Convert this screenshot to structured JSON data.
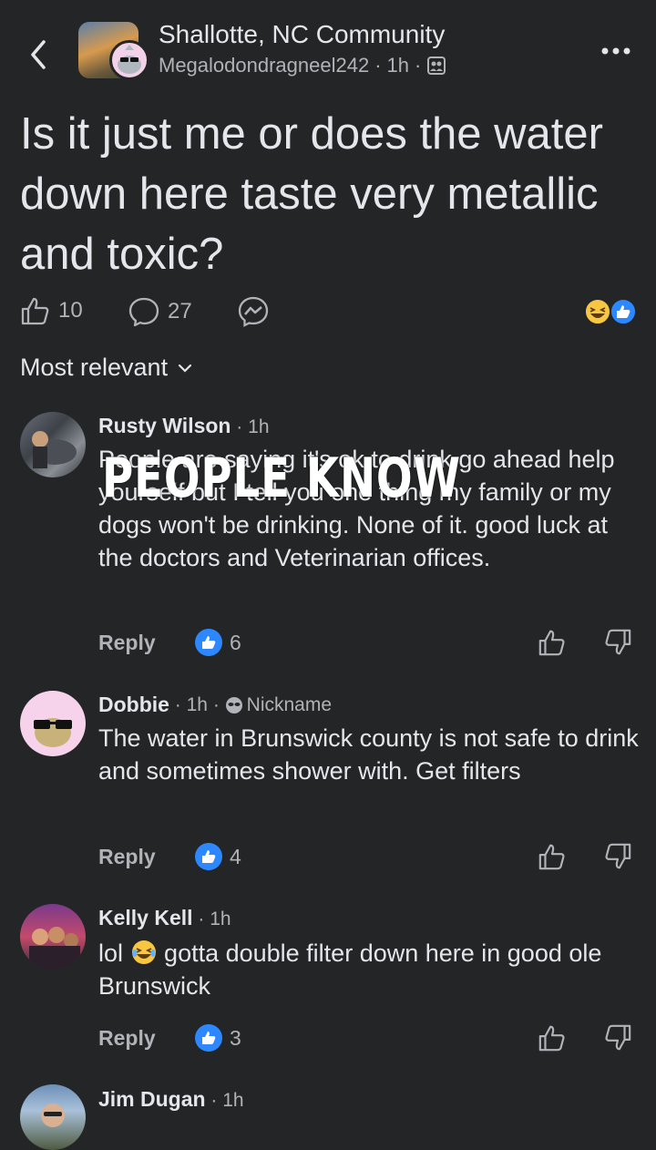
{
  "header": {
    "group_name": "Shallotte, NC Community",
    "author": "Megalodondragneel242",
    "time": "1h"
  },
  "post": {
    "title": "Is it just me or does the water down here taste very metallic and toxic?",
    "like_count": "10",
    "comment_count": "27"
  },
  "sort_label": "Most relevant",
  "overlay_text": "PEOPLE KNOW",
  "comments": [
    {
      "name": "Rusty Wilson",
      "time": "1h",
      "text": "People are saying it's ok to drink go ahead help yourself but I tell you one thing my family or my dogs won't be drinking. None of it.  good luck  at the doctors and Veterinarian offices.",
      "reply_label": "Reply",
      "likes": "6"
    },
    {
      "name": "Dobbie",
      "time": "1h",
      "badge": "Nickname",
      "text": "The water in Brunswick county is not safe to drink and sometimes shower with. Get filters",
      "reply_label": "Reply",
      "likes": "4"
    },
    {
      "name": "Kelly Kell",
      "time": "1h",
      "text_before_emoji": "lol",
      "text_after_emoji": "gotta double filter down here in good ole Brunswick",
      "reply_label": "Reply",
      "likes": "3"
    },
    {
      "name": "Jim Dugan",
      "time": "1h"
    }
  ],
  "icons": {
    "back": "chevron-left-icon",
    "more": "more-dots-icon",
    "like": "thumbs-up-icon",
    "comment": "comment-bubble-icon",
    "share": "messenger-icon",
    "dislike": "thumbs-down-icon",
    "privacy": "members-icon",
    "nickname": "mask-icon"
  },
  "colors": {
    "background": "#242526",
    "text": "#e4e6eb",
    "muted": "#b0b3b8",
    "like_blue": "#2d88ff"
  }
}
